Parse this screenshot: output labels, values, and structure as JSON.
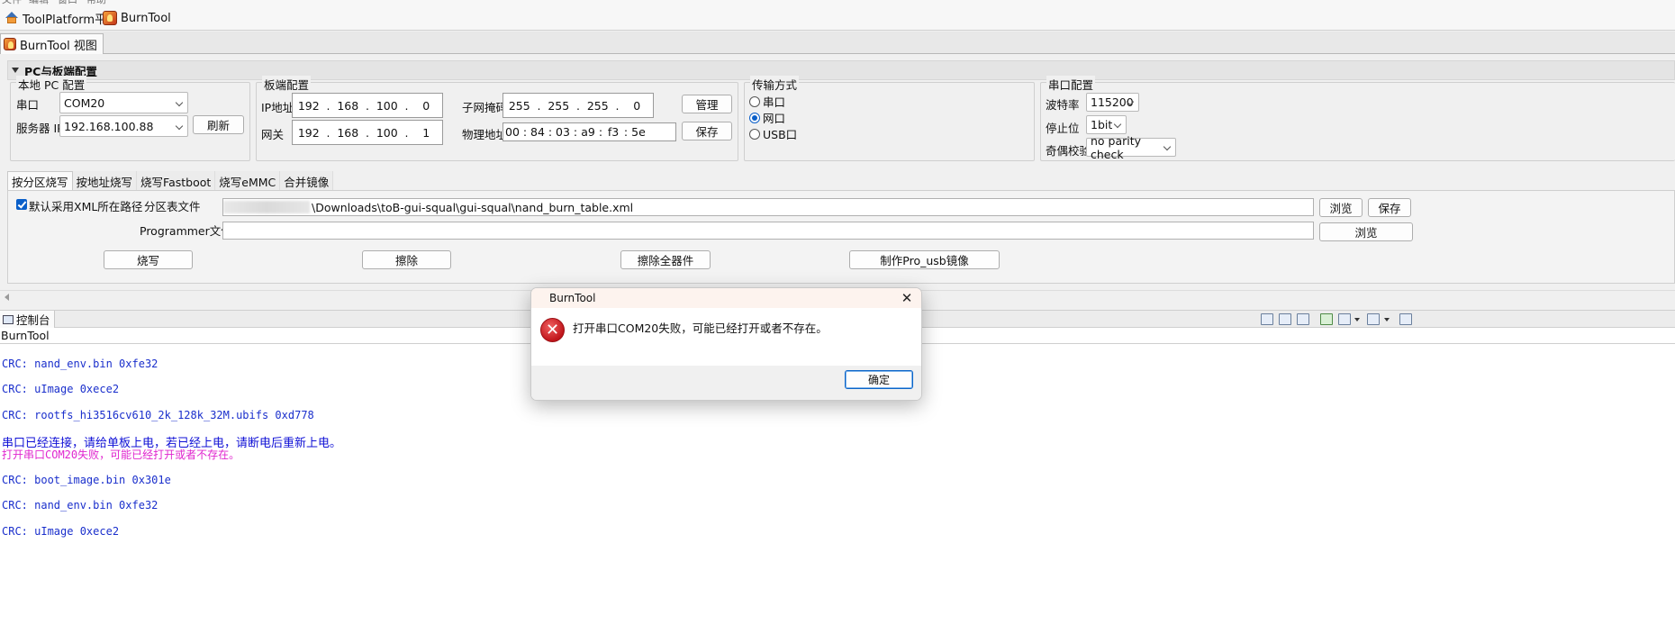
{
  "menu": [
    "文件",
    "编辑",
    "窗口",
    "帮助"
  ],
  "toolbar": {
    "toolplatform_label": "ToolPlatform平台",
    "burntool_label": "BurnTool"
  },
  "view_tab": {
    "label": "BurnTool 视图"
  },
  "pc_section": {
    "title": "PC与板端配置",
    "local_pc": {
      "title": "本地 PC 配置",
      "serial_label": "串口",
      "serial_value": "COM20",
      "server_ip_label": "服务器 IP",
      "server_ip_value": "192.168.100.88",
      "refresh_label": "刷新"
    },
    "board": {
      "title": "板端配置",
      "ip_label": "IP地址",
      "ip": [
        "192",
        "168",
        "100",
        "0"
      ],
      "gateway_label": "网关",
      "gateway": [
        "192",
        "168",
        "100",
        "1"
      ],
      "mask_label": "子网掩码",
      "mask": [
        "255",
        "255",
        "255",
        "0"
      ],
      "mac_label": "物理地址",
      "mac": [
        "00",
        "84",
        "03",
        "a9",
        "f3",
        "5e"
      ],
      "manage_label": "管理",
      "save_label": "保存"
    },
    "transfer": {
      "title": "传输方式",
      "options": [
        "串口",
        "网口",
        "USB口"
      ],
      "selected": "网口"
    },
    "serial_cfg": {
      "title": "串口配置",
      "baud_label": "波特率",
      "baud_value": "115200",
      "stop_label": "停止位",
      "stop_value": "1bit",
      "parity_label": "奇偶校验",
      "parity_value": "no parity check"
    }
  },
  "burn_tabs": [
    "按分区烧写",
    "按地址烧写",
    "烧写Fastboot",
    "烧写eMMC",
    "合并镜像"
  ],
  "burn_panel": {
    "use_xml_path_label": "默认采用XML所在路径",
    "use_xml_path_checked": true,
    "partition_file_label": "分区表文件",
    "partition_file_value": "\\Downloads\\toB-gui-squal\\gui-squal\\nand_burn_table.xml",
    "programmer_label": "Programmer文件",
    "programmer_value": "",
    "browse_label": "浏览",
    "save_label": "保存",
    "burn_btn": "烧写",
    "erase_btn": "擦除",
    "erase_all_btn": "擦除全器件",
    "make_pro_usb_btn": "制作Pro_usb镜像"
  },
  "console": {
    "tab_label": "控制台",
    "title": "BurnTool",
    "lines": [
      {
        "text": "CRC: nand_env.bin 0xfe32",
        "color": "#1a2fcc"
      },
      {
        "text": "CRC: uImage 0xece2",
        "color": "#1a2fcc"
      },
      {
        "text": "CRC: rootfs_hi3516cv610_2k_128k_32M.ubifs 0xd778",
        "color": "#1a2fcc"
      },
      {
        "text": "串口已经连接，请给单板上电，若已经上电，请断电后重新上电。",
        "color": "#1011d6"
      },
      {
        "text": "打开串口COM20失败，可能已经打开或者不存在。",
        "color": "#e026cf"
      },
      {
        "text": "CRC: boot_image.bin 0x301e",
        "color": "#1a2fcc"
      },
      {
        "text": "CRC: nand_env.bin 0xfe32",
        "color": "#1a2fcc"
      },
      {
        "text": "CRC: uImage 0xece2",
        "color": "#1a2fcc"
      }
    ]
  },
  "dialog": {
    "title": "BurnTool",
    "message": "打开串口COM20失败，可能已经打开或者不存在。",
    "ok_label": "确定"
  }
}
